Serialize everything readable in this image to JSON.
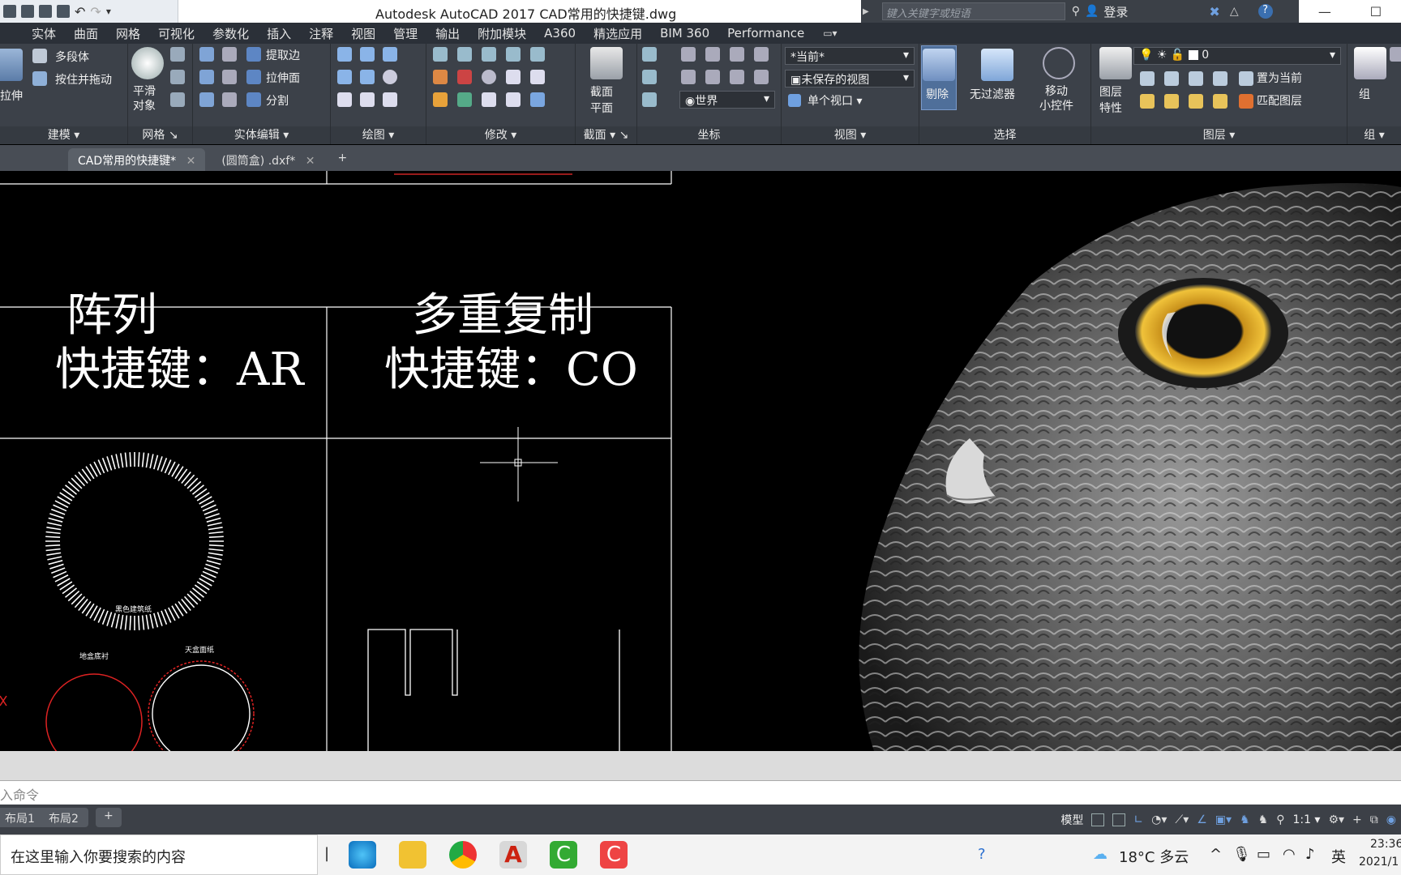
{
  "window": {
    "title": "Autodesk AutoCAD 2017    CAD常用的快捷键.dwg",
    "search_placeholder": "键入关键字或短语",
    "login_label": "登录"
  },
  "ribbon_tabs": [
    "实体",
    "曲面",
    "网格",
    "可视化",
    "参数化",
    "插入",
    "注释",
    "视图",
    "管理",
    "输出",
    "附加模块",
    "A360",
    "精选应用",
    "BIM 360",
    "Performance"
  ],
  "panels": {
    "modeling": {
      "label": "建模",
      "extrude": "拉伸",
      "polysolid": "多段体",
      "presspull": "按住并拖动"
    },
    "mesh": {
      "label": "网格",
      "smooth_object": "平滑\n对象"
    },
    "solid_edit": {
      "label": "实体编辑",
      "extract_edges": "提取边",
      "extrude_faces": "拉伸面",
      "separate": "分割"
    },
    "draw": {
      "label": "绘图"
    },
    "modify": {
      "label": "修改"
    },
    "section": {
      "label": "截面",
      "section_plane": "截面\n平面"
    },
    "coordinates": {
      "label": "坐标",
      "world": "世界"
    },
    "view": {
      "label": "视图",
      "visual_style": "*当前*",
      "named_view": "未保存的视图",
      "single_viewport": "单个视口"
    },
    "selection": {
      "label": "选择",
      "cull": "剔除",
      "no_filter": "无过滤器",
      "move_gizmo": "移动\n小控件"
    },
    "layers": {
      "label": "图层",
      "layer_properties": "图层\n特性",
      "layer_current": "0",
      "set_current": "置为当前",
      "match_layer": "匹配图层"
    },
    "groups": {
      "label": "组",
      "group": "组"
    }
  },
  "doc_tabs": [
    {
      "label": "CAD常用的快捷键*",
      "active": true
    },
    {
      "label": "(圆筒盒) .dxf*",
      "active": false
    }
  ],
  "drawing": {
    "array_title": "阵列",
    "array_shortcut": "快捷键：AR",
    "copy_title": "多重复制",
    "copy_shortcut": "快捷键：CO",
    "small_label_top": "黑色建筑纸",
    "small_label_left": "地盒底衬",
    "small_label_right": "天盒面纸"
  },
  "command_line": {
    "prompt": "入命令"
  },
  "layout_tabs": [
    "布局1",
    "布局2"
  ],
  "status_bar": {
    "model_label": "模型",
    "scale": "1:1"
  },
  "taskbar": {
    "search_text": "在这里输入你要搜索的内容",
    "weather": "18°C  多云",
    "ime": "英",
    "time": "23:36",
    "date": "2021/1"
  }
}
